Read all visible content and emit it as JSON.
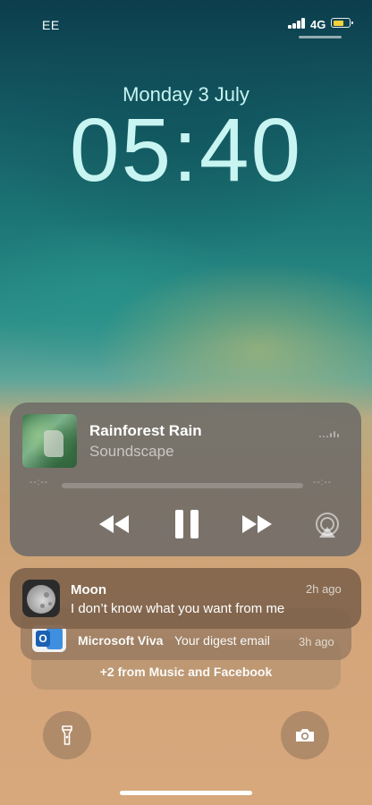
{
  "status_bar": {
    "carrier": "EE",
    "network": "4G",
    "signal_bars": 4,
    "battery_icon": "battery-icon",
    "battery_color": "#f3d23a"
  },
  "lock_screen": {
    "date": "Monday 3 July",
    "time": "05:40"
  },
  "now_playing": {
    "title": "Rainforest Rain",
    "subtitle": "Soundscape",
    "elapsed": "--:--",
    "remaining": "--:--",
    "progress": 0,
    "controls": [
      "rewind-icon",
      "pause-icon",
      "fast-forward-icon",
      "airplay-icon"
    ]
  },
  "notifications": {
    "main": {
      "app": "Moon",
      "body": "I don’t know what you want from me",
      "time": "2h ago"
    },
    "stacked": {
      "app": "Microsoft Viva",
      "body": "Your digest email",
      "time": "3h ago"
    },
    "more_summary": "+2 from Music and Facebook"
  },
  "quick_actions": {
    "left_icon": "flashlight-icon",
    "right_icon": "camera-icon"
  }
}
